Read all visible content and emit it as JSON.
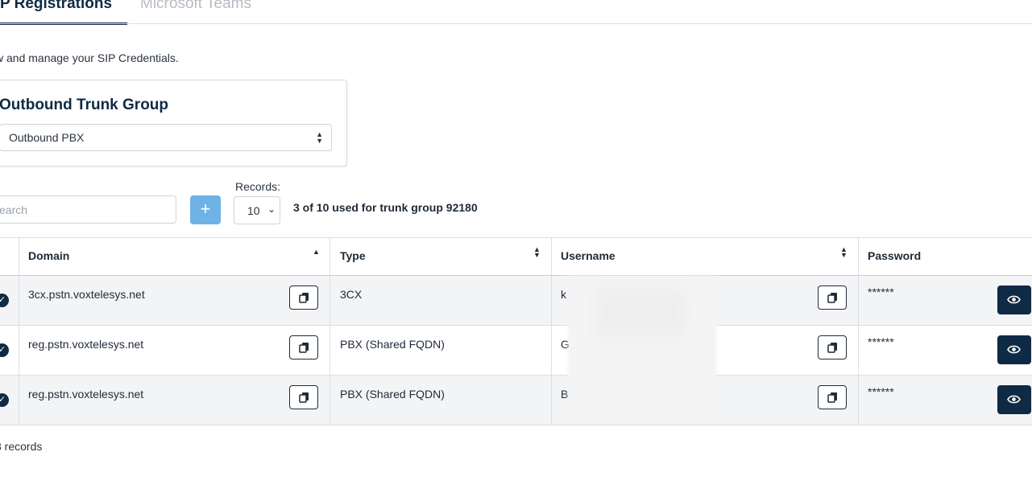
{
  "tabs": [
    {
      "label": "P Registrations",
      "active": true
    },
    {
      "label": "Microsoft Teams",
      "active": false
    }
  ],
  "subtitle": "w and manage your SIP Credentials.",
  "trunk_group": {
    "title": "Outbound Trunk Group",
    "selected": "Outbound PBX"
  },
  "toolbar": {
    "search_placeholder": "earch",
    "add_label": "+",
    "records_label": "Records:",
    "records_value": "10",
    "usage_text": "3 of 10 used for trunk group 92180"
  },
  "table": {
    "headers": [
      "Domain",
      "Type",
      "Username",
      "Password"
    ],
    "rows": [
      {
        "domain": "3cx.pstn.voxtelesys.net",
        "type": "3CX",
        "username": "k",
        "password": "******"
      },
      {
        "domain": "reg.pstn.voxtelesys.net",
        "type": "PBX (Shared FQDN)",
        "username": "G",
        "password": "******"
      },
      {
        "domain": "reg.pstn.voxtelesys.net",
        "type": "PBX (Shared FQDN)",
        "username": "B",
        "password": "******"
      }
    ]
  },
  "footer": "3 records",
  "colors": {
    "primary": "#0f2a44",
    "accent": "#6fb2e6",
    "row_alt": "#f3f4f6"
  }
}
